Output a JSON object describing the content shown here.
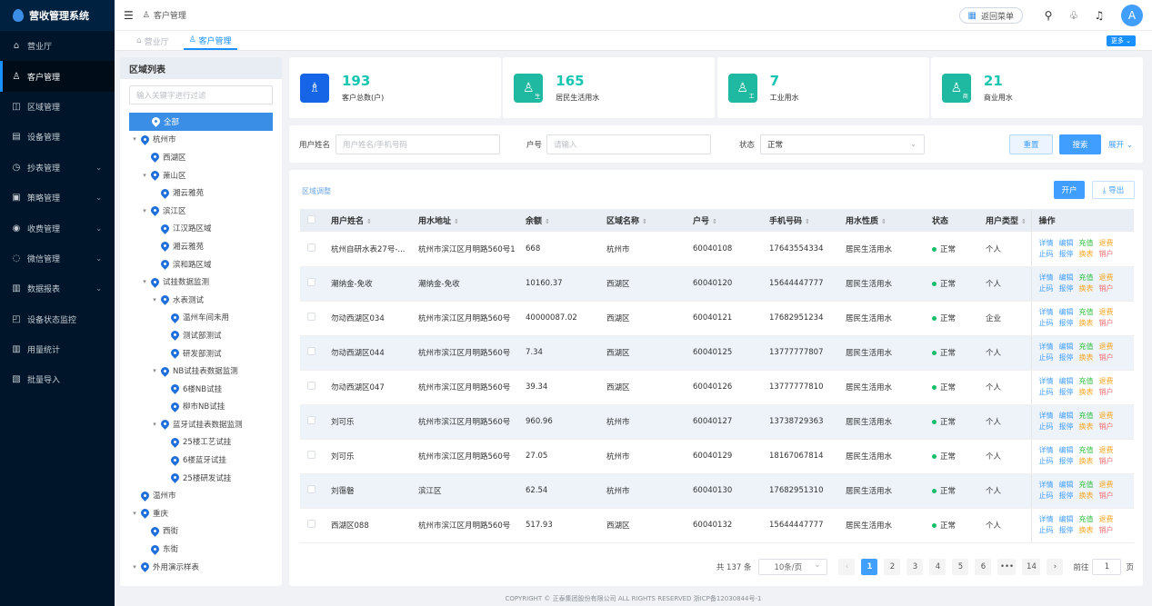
{
  "app": {
    "title": "营收管理系统"
  },
  "sidebar": {
    "items": [
      {
        "label": "营业厅",
        "icon": "home-icon",
        "glyph": "⌂",
        "has_arrow": false,
        "active": false
      },
      {
        "label": "客户管理",
        "icon": "user-icon",
        "glyph": "♙",
        "has_arrow": false,
        "active": true
      },
      {
        "label": "区域管理",
        "icon": "map-icon",
        "glyph": "◫",
        "has_arrow": false,
        "active": false
      },
      {
        "label": "设备管理",
        "icon": "device-icon",
        "glyph": "▤",
        "has_arrow": false,
        "active": false
      },
      {
        "label": "抄表管理",
        "icon": "meter-icon",
        "glyph": "◷",
        "has_arrow": true,
        "active": false
      },
      {
        "label": "策略管理",
        "icon": "strategy-icon",
        "glyph": "▣",
        "has_arrow": true,
        "active": false
      },
      {
        "label": "收费管理",
        "icon": "charge-icon",
        "glyph": "◉",
        "has_arrow": true,
        "active": false
      },
      {
        "label": "微信管理",
        "icon": "wechat-icon",
        "glyph": "◌",
        "has_arrow": true,
        "active": false
      },
      {
        "label": "数据报表",
        "icon": "report-icon",
        "glyph": "▥",
        "has_arrow": true,
        "active": false
      },
      {
        "label": "设备状态监控",
        "icon": "monitor-icon",
        "glyph": "◰",
        "has_arrow": false,
        "active": false
      },
      {
        "label": "用量统计",
        "icon": "stats-icon",
        "glyph": "▥",
        "has_arrow": false,
        "active": false
      },
      {
        "label": "批量导入",
        "icon": "import-icon",
        "glyph": "▧",
        "has_arrow": false,
        "active": false
      }
    ]
  },
  "header": {
    "breadcrumb": "客户管理",
    "back_label": "返回菜单",
    "avatar_letter": "A"
  },
  "tabs": [
    {
      "label": "营业厅",
      "active": false
    },
    {
      "label": "客户管理",
      "active": true
    }
  ],
  "more_label": "更多 ⌄",
  "region": {
    "title": "区域列表",
    "filter_placeholder": "输入关键字进行过滤",
    "tree": [
      {
        "label": "全部",
        "level": 0,
        "caret": "",
        "selected": true
      },
      {
        "label": "杭州市",
        "level": 0,
        "caret": "▾",
        "selected": false
      },
      {
        "label": "西湖区",
        "level": 1,
        "caret": "",
        "selected": false
      },
      {
        "label": "萧山区",
        "level": 1,
        "caret": "▾",
        "selected": false
      },
      {
        "label": "湘云雅苑",
        "level": 2,
        "caret": "",
        "selected": false
      },
      {
        "label": "滨江区",
        "level": 1,
        "caret": "▾",
        "selected": false
      },
      {
        "label": "江汉路区域",
        "level": 2,
        "caret": "",
        "selected": false
      },
      {
        "label": "湘云雅苑",
        "level": 2,
        "caret": "",
        "selected": false
      },
      {
        "label": "滨和路区域",
        "level": 2,
        "caret": "",
        "selected": false
      },
      {
        "label": "试挂数据监测",
        "level": 1,
        "caret": "▾",
        "selected": false
      },
      {
        "label": "水表测试",
        "level": 2,
        "caret": "▾",
        "selected": false
      },
      {
        "label": "温州车间未用",
        "level": 3,
        "caret": "",
        "selected": false
      },
      {
        "label": "测试部测试",
        "level": 3,
        "caret": "",
        "selected": false
      },
      {
        "label": "研发部测试",
        "level": 3,
        "caret": "",
        "selected": false
      },
      {
        "label": "NB试挂表数据监测",
        "level": 2,
        "caret": "▾",
        "selected": false
      },
      {
        "label": "6楼NB试挂",
        "level": 3,
        "caret": "",
        "selected": false
      },
      {
        "label": "柳市NB试挂",
        "level": 3,
        "caret": "",
        "selected": false
      },
      {
        "label": "蓝牙试挂表数据监测",
        "level": 2,
        "caret": "▾",
        "selected": false
      },
      {
        "label": "25楼工艺试挂",
        "level": 3,
        "caret": "",
        "selected": false
      },
      {
        "label": "6楼蓝牙试挂",
        "level": 3,
        "caret": "",
        "selected": false
      },
      {
        "label": "25楼研发试挂",
        "level": 3,
        "caret": "",
        "selected": false
      },
      {
        "label": "温州市",
        "level": 0,
        "caret": "",
        "selected": false
      },
      {
        "label": "重庆",
        "level": 0,
        "caret": "▾",
        "selected": false
      },
      {
        "label": "西街",
        "level": 1,
        "caret": "",
        "selected": false
      },
      {
        "label": "东街",
        "level": 1,
        "caret": "",
        "selected": false
      },
      {
        "label": "外用演示样表",
        "level": 0,
        "caret": "▾",
        "selected": false
      }
    ]
  },
  "stats": [
    {
      "value": "193",
      "label": "客户总数(户)",
      "color": "#1565e6",
      "badge": "",
      "value_color": "#17c6b0"
    },
    {
      "value": "165",
      "label": "居民生活用水",
      "color": "#1fb8a0",
      "badge": "生",
      "value_color": "#17c6b0"
    },
    {
      "value": "7",
      "label": "工业用水",
      "color": "#1fb8a0",
      "badge": "工",
      "value_color": "#17c6b0"
    },
    {
      "value": "21",
      "label": "商业用水",
      "color": "#1fb8a0",
      "badge": "商",
      "value_color": "#17c6b0"
    }
  ],
  "search": {
    "name_label": "用户姓名",
    "name_placeholder": "用户姓名/手机号码",
    "account_label": "户号",
    "account_placeholder": "请输入",
    "status_label": "状态",
    "status_value": "正常",
    "reset_label": "重置",
    "search_label": "搜索",
    "expand_label": "展开 ⌄"
  },
  "table": {
    "region_adjust_label": "区域调整",
    "open_label": "开户",
    "export_label": "⤓ 导出",
    "columns": [
      "用户姓名",
      "用水地址",
      "余额",
      "区域名称",
      "户号",
      "手机号码",
      "用水性质",
      "状态",
      "用户类型",
      "操作"
    ],
    "rows": [
      {
        "name": "杭州自研水表27号-...",
        "address": "杭州市滨江区月明路560号1",
        "balance": "668",
        "region": "杭州市",
        "account": "60040108",
        "phone": "17643554334",
        "type": "居民生活用水",
        "status": "正常",
        "utype": "个人"
      },
      {
        "name": "潮纳金-免收",
        "address": "潮纳金-免收",
        "balance": "10160.37",
        "region": "西湖区",
        "account": "60040120",
        "phone": "15644447777",
        "type": "居民生活用水",
        "status": "正常",
        "utype": "个人"
      },
      {
        "name": "勿动西湖区034",
        "address": "杭州市滨江区月明路560号",
        "balance": "40000087.02",
        "region": "西湖区",
        "account": "60040121",
        "phone": "17682951234",
        "type": "居民生活用水",
        "status": "正常",
        "utype": "企业"
      },
      {
        "name": "勿动西湖区044",
        "address": "杭州市滨江区月明路560号",
        "balance": "7.34",
        "region": "西湖区",
        "account": "60040125",
        "phone": "13777777807",
        "type": "居民生活用水",
        "status": "正常",
        "utype": "个人"
      },
      {
        "name": "勿动西湖区047",
        "address": "杭州市滨江区月明路560号",
        "balance": "39.34",
        "region": "西湖区",
        "account": "60040126",
        "phone": "13777777810",
        "type": "居民生活用水",
        "status": "正常",
        "utype": "个人"
      },
      {
        "name": "刘可乐",
        "address": "杭州市滨江区月明路560号",
        "balance": "960.96",
        "region": "杭州市",
        "account": "60040127",
        "phone": "13738729363",
        "type": "居民生活用水",
        "status": "正常",
        "utype": "个人"
      },
      {
        "name": "刘可乐",
        "address": "杭州市滨江区月明路560号",
        "balance": "27.05",
        "region": "杭州市",
        "account": "60040129",
        "phone": "18167067814",
        "type": "居民生活用水",
        "status": "正常",
        "utype": "个人"
      },
      {
        "name": "刘霭磐",
        "address": "滨江区",
        "balance": "62.54",
        "region": "杭州市",
        "account": "60040130",
        "phone": "17682951310",
        "type": "居民生活用水",
        "status": "正常",
        "utype": "个人"
      },
      {
        "name": "西湖区088",
        "address": "杭州市滨江区月明路560号",
        "balance": "517.93",
        "region": "西湖区",
        "account": "60040132",
        "phone": "15644447777",
        "type": "居民生活用水",
        "status": "正常",
        "utype": "个人"
      }
    ],
    "ops": {
      "detail": "详情",
      "edit": "编辑",
      "recharge": "充值",
      "refund": "退费",
      "stop_code": "止码",
      "report_stop": "报停",
      "change_meter": "换表",
      "close_account": "销户"
    }
  },
  "pager": {
    "total": "共 137 条",
    "size": "10条/页",
    "pages": [
      "1",
      "2",
      "3",
      "4",
      "5",
      "6",
      "•••",
      "14"
    ],
    "prev": "‹",
    "next": "›",
    "goto_label": "前往",
    "goto_value": "1",
    "page_unit": "页"
  },
  "footer": {
    "text": "COPYRIGHT © 正泰集团股份有限公司 ALL RIGHTS RESERVED   浙ICP备12030844号-1"
  }
}
